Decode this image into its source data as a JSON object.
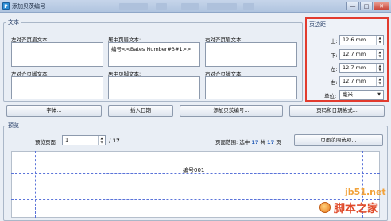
{
  "window": {
    "title": "添加贝茨编号",
    "app_icon_letter": "P",
    "close_label": "✕",
    "maximize_label": "□",
    "minimize_label": "—"
  },
  "text_group": {
    "label": "文本",
    "left_header_label": "左对齐页眉文本:",
    "center_header_label": "居中页眉文本:",
    "right_header_label": "右对齐页眉文本:",
    "left_footer_label": "左对齐页脚文本:",
    "center_footer_label": "居中页脚文本:",
    "right_footer_label": "右对齐页脚文本:",
    "center_header_value": "编号<<Bates Number#3#1>>",
    "left_header_value": "",
    "right_header_value": "",
    "left_footer_value": "",
    "center_footer_value": "",
    "right_footer_value": ""
  },
  "margins": {
    "label": "页边距",
    "top_label": "上:",
    "top_value": "12.6 mm",
    "bottom_label": "下:",
    "bottom_value": "12.7 mm",
    "left_label": "左:",
    "left_value": "12.7 mm",
    "right_label": "右:",
    "right_value": "12.7 mm",
    "unit_label": "单位:",
    "unit_value": "毫米"
  },
  "buttons": {
    "font": "字体...",
    "insert_date": "插入日期",
    "add_bates": "添加贝茨编号...",
    "page_date_format": "页码和日期格式...",
    "page_range_options": "页面范围选项..."
  },
  "preview": {
    "label": "预览",
    "preview_page_label": "预览页面",
    "preview_page_value": "1",
    "total_pages": "/ 17",
    "range_label": "页面范围: 选中",
    "range_selected": "17",
    "range_mid": "共",
    "range_total": "17",
    "range_suffix": "页",
    "page_stamp": "编号001"
  },
  "watermark": {
    "site": "jb51.net",
    "name": "脚本之家"
  },
  "colors": {
    "highlight_border": "#e23b2e",
    "guide_line": "#5a73d9",
    "group_label": "#243c66"
  }
}
